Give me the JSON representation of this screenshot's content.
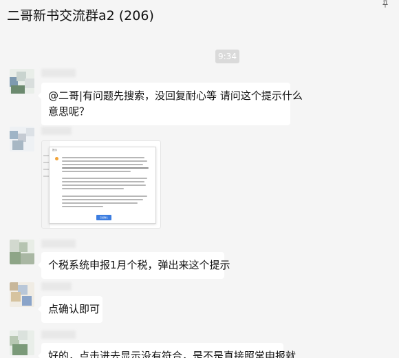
{
  "header": {
    "title": "二哥新书交流群a2 (206)"
  },
  "timestamp": "9:34",
  "messages": [
    {
      "type": "text",
      "text_line1": "@二哥|有问题先搜索，没回复耐心等 请问这个提示什么",
      "text_line2": "意思呢？"
    },
    {
      "type": "image",
      "dialog_title": "提示",
      "confirm_label": "已经确认"
    },
    {
      "type": "text",
      "text": "个税系统申报1月个税，弹出来这个提示"
    },
    {
      "type": "text",
      "text": "点确认即可"
    },
    {
      "type": "text",
      "text": "好的，点击进去显示没有符合，是不是直接照常申报就"
    }
  ],
  "colors": {
    "background": "#f5f5f5",
    "bubble": "#ffffff",
    "confirm_button": "#3c7de0",
    "warning_icon": "#f2a43a"
  },
  "icons": {
    "pin": "pin-icon"
  }
}
